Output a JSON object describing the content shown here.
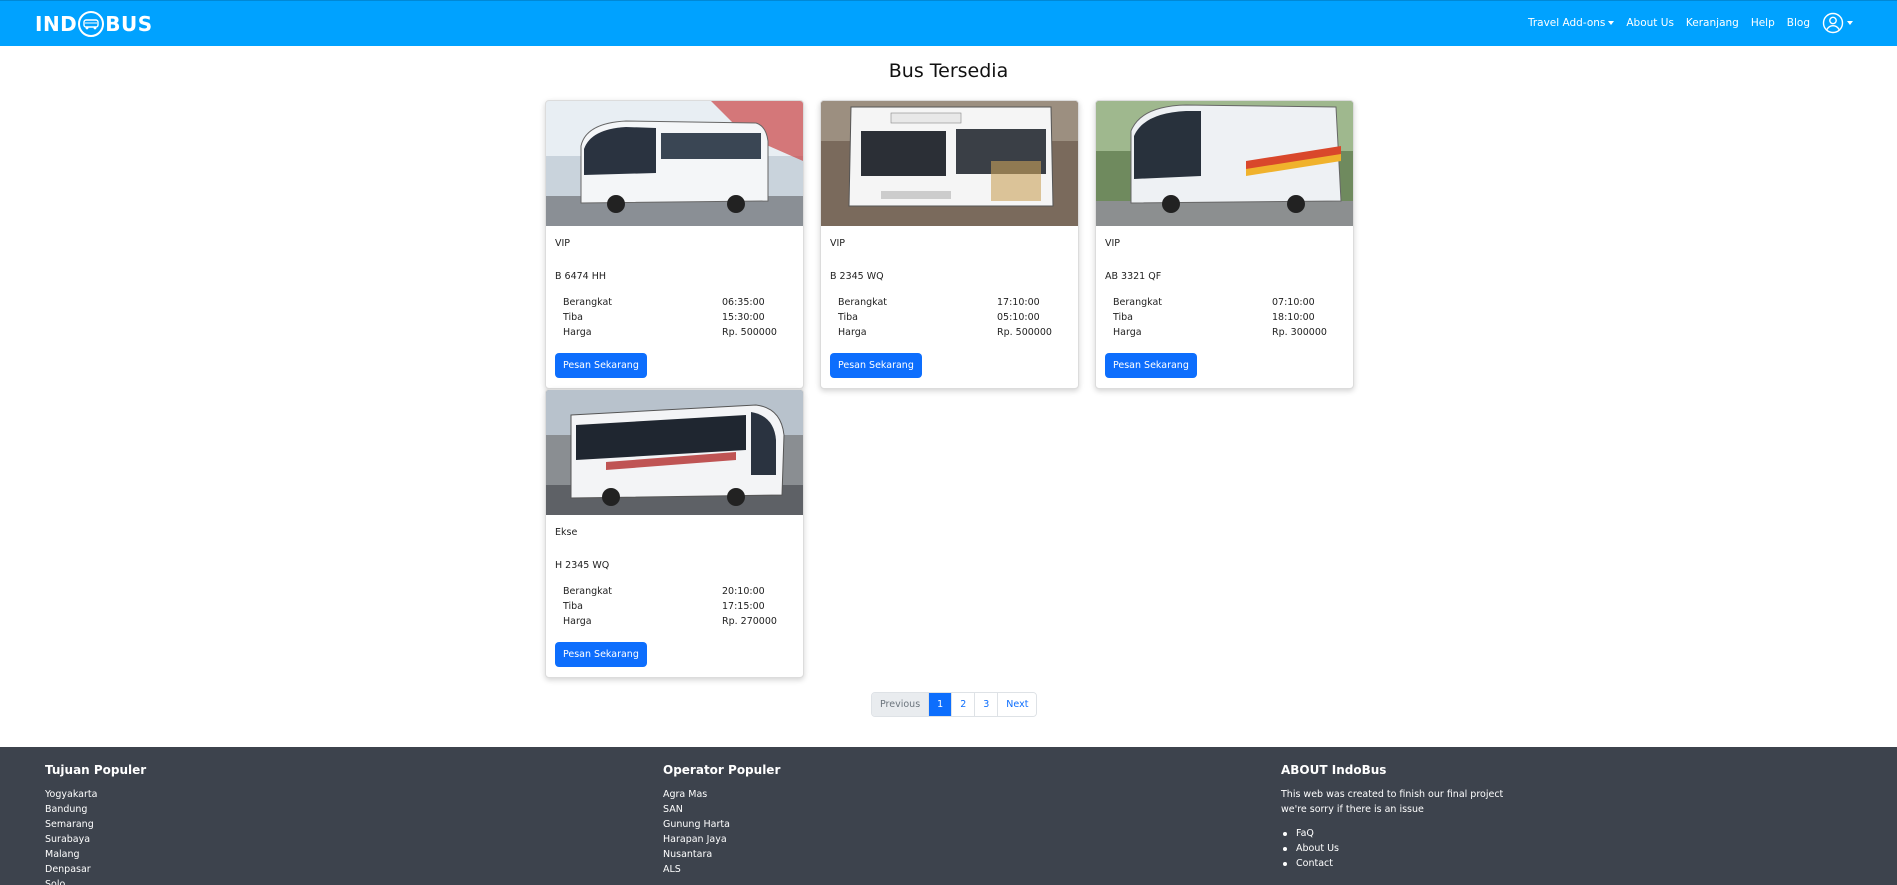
{
  "navbar": {
    "brand_left": "IND",
    "brand_right": "BUS",
    "links": [
      "Travel Add-ons",
      "About Us",
      "Keranjang",
      "Help",
      "Blog"
    ],
    "accent": "#00a2ff"
  },
  "main": {
    "title": "Bus Tersedia",
    "labels": {
      "depart": "Berangkat",
      "arrive": "Tiba",
      "price": "Harga"
    },
    "book_label": "Pesan Sekarang",
    "cards": [
      {
        "type": "VIP",
        "plate": "B 6474 HH",
        "depart": "06:35:00",
        "arrive": "15:30:00",
        "price": "Rp. 500000"
      },
      {
        "type": "VIP",
        "plate": "B 2345 WQ",
        "depart": "17:10:00",
        "arrive": "05:10:00",
        "price": "Rp. 500000"
      },
      {
        "type": "VIP",
        "plate": "AB 3321 QF",
        "depart": "07:10:00",
        "arrive": "18:10:00",
        "price": "Rp. 300000"
      },
      {
        "type": "Ekse",
        "plate": "H 2345 WQ",
        "depart": "20:10:00",
        "arrive": "17:15:00",
        "price": "Rp. 270000"
      }
    ]
  },
  "pagination": {
    "previous": "Previous",
    "pages": [
      "1",
      "2",
      "3"
    ],
    "next": "Next",
    "active": "1"
  },
  "footer": {
    "col1": {
      "title": "Tujuan Populer",
      "items": [
        "Yogyakarta",
        "Bandung",
        "Semarang",
        "Surabaya",
        "Malang",
        "Denpasar",
        "Solo"
      ]
    },
    "col2": {
      "title": "Operator Populer",
      "items": [
        "Agra Mas",
        "SAN",
        "Gunung Harta",
        "Harapan Jaya",
        "Nusantara",
        "ALS"
      ]
    },
    "col3": {
      "title": "ABOUT IndoBus",
      "text1": "This web was created to finish our final project",
      "text2": "we're sorry if there is an issue",
      "items": [
        "FaQ",
        "About Us",
        "Contact"
      ]
    }
  }
}
